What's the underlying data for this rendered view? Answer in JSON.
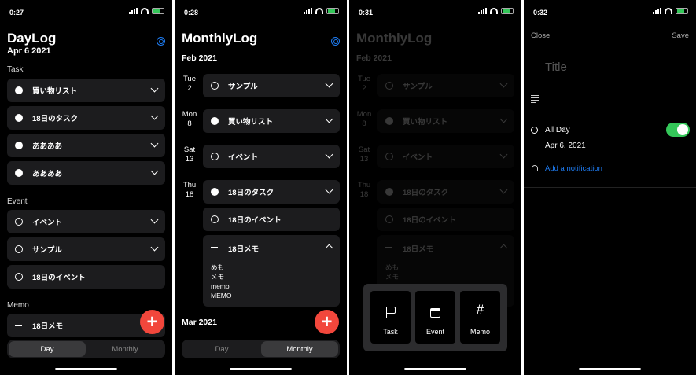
{
  "screen1": {
    "time": "0:27",
    "title": "DayLog",
    "date": "Apr 6 2021",
    "task_header": "Task",
    "tasks": [
      "買い物リスト",
      "18日のタスク",
      "ああああ",
      "ああああ"
    ],
    "event_header": "Event",
    "events": [
      "イベント",
      "サンプル",
      "18日のイベント"
    ],
    "memo_header": "Memo",
    "memos": [
      "18日メモ"
    ],
    "seg_day": "Day",
    "seg_monthly": "Monthly",
    "fab": "+"
  },
  "screen2": {
    "time": "0:28",
    "title": "MonthlyLog",
    "month1": "Feb 2021",
    "days": [
      {
        "dow": "Tue",
        "num": "2"
      },
      {
        "dow": "Mon",
        "num": "8"
      },
      {
        "dow": "Sat",
        "num": "13"
      },
      {
        "dow": "Thu",
        "num": "18"
      }
    ],
    "items": [
      "サンプル",
      "買い物リスト",
      "イベント",
      "18日のタスク",
      "18日のイベント",
      "18日メモ"
    ],
    "memo_lines": [
      "めも",
      "メモ",
      "memo",
      "MEMO"
    ],
    "month2": "Mar 2021",
    "seg_day": "Day",
    "seg_monthly": "Monthly",
    "fab": "+"
  },
  "screen3": {
    "time": "0:31",
    "menu": [
      {
        "label": "Task",
        "icon": "flag-icon"
      },
      {
        "label": "Event",
        "icon": "calendar-icon"
      },
      {
        "label": "Memo",
        "icon": "hash-icon",
        "glyph": "#"
      }
    ]
  },
  "screen4": {
    "time": "0:32",
    "close": "Close",
    "save": "Save",
    "title_placeholder": "Title",
    "all_day": "All Day",
    "date": "Apr 6, 2021",
    "add_notification": "Add a notification"
  },
  "colors": {
    "accent": "#1e7cf2",
    "fab": "#f2473c",
    "toggle_on": "#34c759",
    "card": "#1c1c1e"
  }
}
